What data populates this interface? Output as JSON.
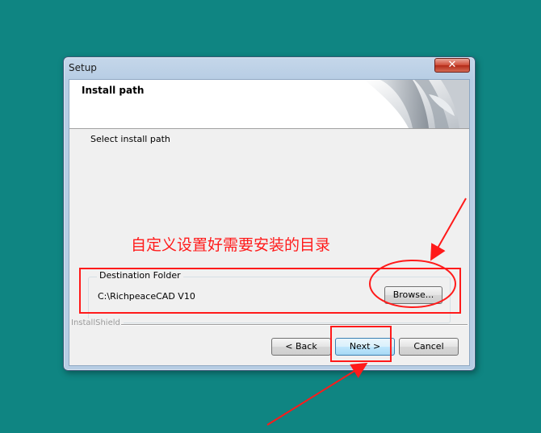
{
  "window": {
    "title": "Setup",
    "close_label": "✕"
  },
  "header": {
    "title": "Install path"
  },
  "main": {
    "subtitle": "Select install path",
    "annotation": "自定义设置好需要安装的目录",
    "destination": {
      "group_label": "Destination Folder",
      "path": "C:\\RichpeaceCAD V10",
      "browse_label": "Browse..."
    },
    "brand": "InstallShield"
  },
  "buttons": {
    "back": "< Back",
    "next": "Next >",
    "cancel": "Cancel"
  },
  "colors": {
    "desktop": "#0f8582",
    "annotation_red": "#ff1a1a",
    "close_red": "#cf4b36"
  }
}
